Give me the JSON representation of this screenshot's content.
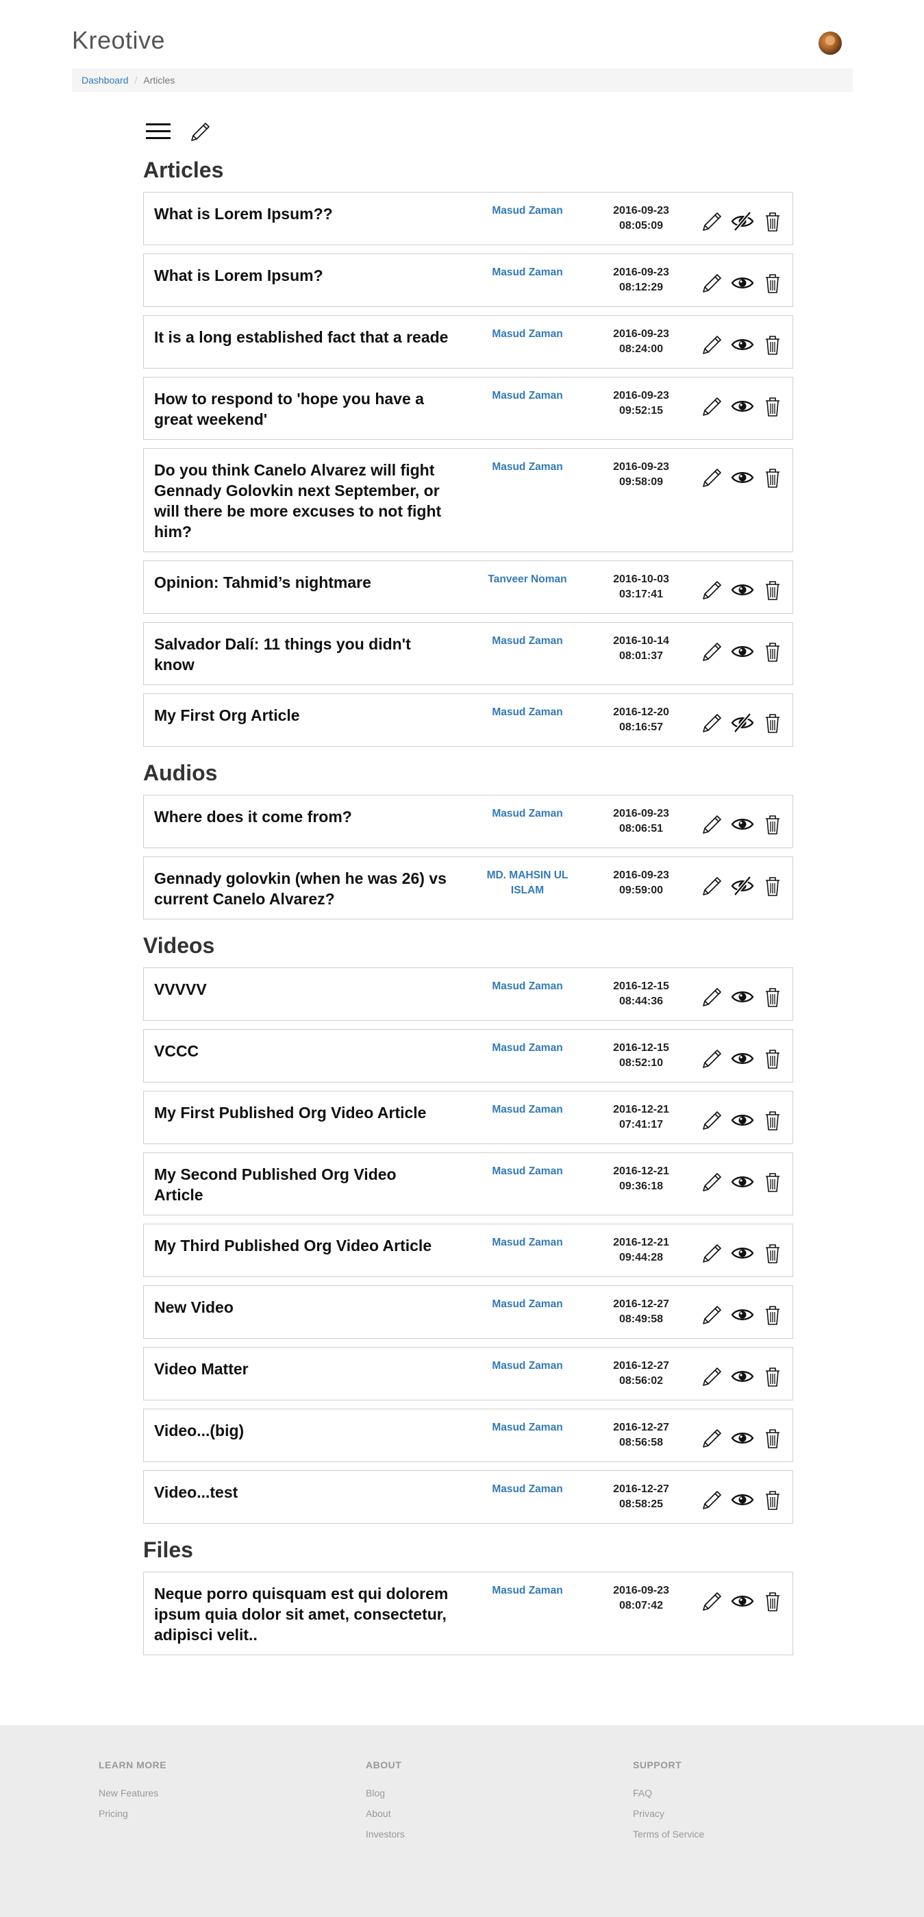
{
  "header": {
    "brand": "Kreotive",
    "breadcrumb": {
      "home": "Dashboard",
      "current": "Articles"
    }
  },
  "sections": [
    {
      "title": "Articles",
      "items": [
        {
          "title": "What is Lorem Ipsum??",
          "author": "Masud Zaman",
          "date": "2016-09-23",
          "time": "08:05:09",
          "visible": false
        },
        {
          "title": "What is Lorem Ipsum?",
          "author": "Masud Zaman",
          "date": "2016-09-23",
          "time": "08:12:29",
          "visible": true
        },
        {
          "title": "It is a long established fact that a reade",
          "author": "Masud Zaman",
          "date": "2016-09-23",
          "time": "08:24:00",
          "visible": true
        },
        {
          "title": "How to respond to 'hope you have a great weekend'",
          "author": "Masud Zaman",
          "date": "2016-09-23",
          "time": "09:52:15",
          "visible": true
        },
        {
          "title": "Do you think Canelo Alvarez will fight Gennady Golovkin next September, or will there be more excuses to not fight him?",
          "author": "Masud Zaman",
          "date": "2016-09-23",
          "time": "09:58:09",
          "visible": true
        },
        {
          "title": "Opinion: Tahmid’s nightmare",
          "author": "Tanveer Noman",
          "date": "2016-10-03",
          "time": "03:17:41",
          "visible": true
        },
        {
          "title": "Salvador Dalí: 11 things you didn't know",
          "author": "Masud Zaman",
          "date": "2016-10-14",
          "time": "08:01:37",
          "visible": true
        },
        {
          "title": "My First Org Article",
          "author": "Masud Zaman",
          "date": "2016-12-20",
          "time": "08:16:57",
          "visible": false
        }
      ]
    },
    {
      "title": "Audios",
      "items": [
        {
          "title": "Where does it come from?",
          "author": "Masud Zaman",
          "date": "2016-09-23",
          "time": "08:06:51",
          "visible": true
        },
        {
          "title": "Gennady golovkin (when he was 26) vs current Canelo Alvarez?",
          "author": "MD. MAHSIN UL ISLAM",
          "date": "2016-09-23",
          "time": "09:59:00",
          "visible": false
        }
      ]
    },
    {
      "title": "Videos",
      "items": [
        {
          "title": "VVVVV",
          "author": "Masud Zaman",
          "date": "2016-12-15",
          "time": "08:44:36",
          "visible": true
        },
        {
          "title": "VCCC",
          "author": "Masud Zaman",
          "date": "2016-12-15",
          "time": "08:52:10",
          "visible": true
        },
        {
          "title": "My First Published Org Video Article",
          "author": "Masud Zaman",
          "date": "2016-12-21",
          "time": "07:41:17",
          "visible": true
        },
        {
          "title": "My Second Published Org Video Article",
          "author": "Masud Zaman",
          "date": "2016-12-21",
          "time": "09:36:18",
          "visible": true
        },
        {
          "title": "My Third Published Org Video Article",
          "author": "Masud Zaman",
          "date": "2016-12-21",
          "time": "09:44:28",
          "visible": true
        },
        {
          "title": "New Video",
          "author": "Masud Zaman",
          "date": "2016-12-27",
          "time": "08:49:58",
          "visible": true
        },
        {
          "title": "Video Matter",
          "author": "Masud Zaman",
          "date": "2016-12-27",
          "time": "08:56:02",
          "visible": true
        },
        {
          "title": "Video...(big)",
          "author": "Masud Zaman",
          "date": "2016-12-27",
          "time": "08:56:58",
          "visible": true
        },
        {
          "title": "Video...test",
          "author": "Masud Zaman",
          "date": "2016-12-27",
          "time": "08:58:25",
          "visible": true
        }
      ]
    },
    {
      "title": "Files",
      "items": [
        {
          "title": "Neque porro quisquam est qui dolorem ipsum quia dolor sit amet, consectetur, adipisci velit..",
          "author": "Masud Zaman",
          "date": "2016-09-23",
          "time": "08:07:42",
          "visible": true
        }
      ]
    }
  ],
  "footer": {
    "columns": [
      {
        "heading": "LEARN MORE",
        "links": [
          "New Features",
          "Pricing"
        ]
      },
      {
        "heading": "ABOUT",
        "links": [
          "Blog",
          "About",
          "Investors"
        ]
      },
      {
        "heading": "SUPPORT",
        "links": [
          "FAQ",
          "Privacy",
          "Terms of Service"
        ]
      }
    ]
  },
  "icons": {
    "menu": "hamburger-icon",
    "new": "pencil-icon",
    "edit": "pencil-icon",
    "visible": "eye-icon",
    "hidden": "eye-slash-icon",
    "delete": "trash-icon"
  },
  "colors": {
    "link": "#337ab7",
    "footer_bg": "#ececec",
    "breadcrumb_bg": "#f5f5f5"
  }
}
